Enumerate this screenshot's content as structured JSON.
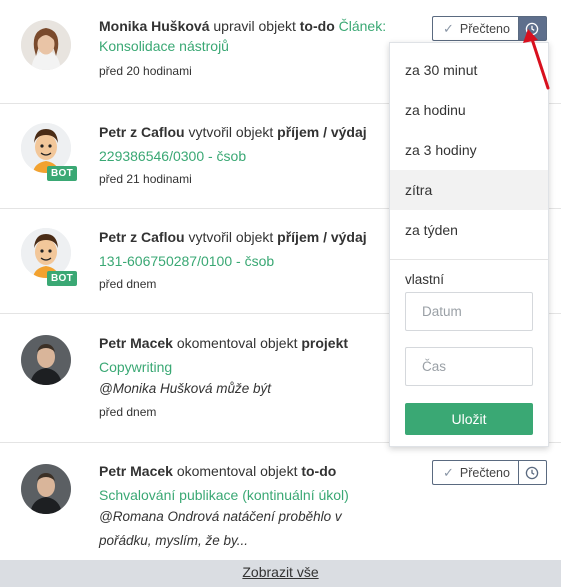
{
  "feed": {
    "items": [
      {
        "actor": "Monika Hušková",
        "action": " upravil objekt ",
        "object_type": "to-do",
        "object_name": "Článek: Konsolidace nástrojů",
        "time": "před 20 hodinami",
        "bot": false
      },
      {
        "actor": "Petr z Caflou",
        "action": " vytvořil objekt ",
        "object_type": "příjem / výdaj",
        "object_name": "229386546/0300 - čsob",
        "time": "před 21 hodinami",
        "bot": true,
        "badge": "BOT"
      },
      {
        "actor": "Petr z Caflou",
        "action": " vytvořil objekt ",
        "object_type": "příjem / výdaj",
        "object_name": "131-606750287/0100 - čsob",
        "time": "před dnem",
        "bot": true,
        "badge": "BOT"
      },
      {
        "actor": "Petr Macek",
        "action": " okomentoval objekt ",
        "object_type": "projekt",
        "object_name": "Copywriting",
        "comment": "@Monika Hušková může být",
        "time": "před dnem",
        "bot": false
      },
      {
        "actor": "Petr Macek",
        "action": " okomentoval objekt ",
        "object_type": "to-do",
        "object_name": "Schvalování publikace (kontinuální úkol)",
        "comment": "@Romana Ondrová natáčení proběhlo v pořádku, myslím, že by...",
        "bot": false
      }
    ],
    "read_label": "Přečteno"
  },
  "snooze_menu": {
    "options": [
      "za 30 minut",
      "za hodinu",
      "za 3 hodiny",
      "zítra",
      "za týden"
    ],
    "highlighted": "zítra",
    "custom_label": "vlastní",
    "date_placeholder": "Datum",
    "time_placeholder": "Čas",
    "save_label": "Uložit"
  },
  "footer": {
    "show_all": "Zobrazit vše"
  },
  "colors": {
    "accent_green": "#3aa874",
    "button_border": "#5a6a80",
    "clock_active": "#5e6f8c",
    "annotation_arrow": "#d8101e"
  }
}
